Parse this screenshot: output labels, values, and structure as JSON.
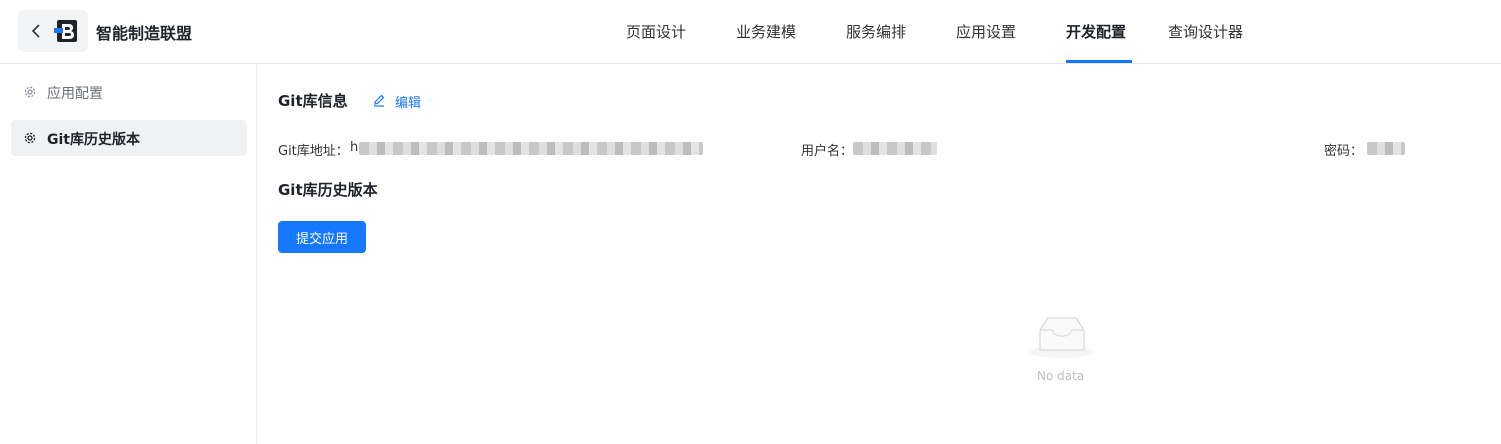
{
  "header": {
    "app_title": "智能制造联盟",
    "nav": [
      {
        "label": "页面设计",
        "active": false
      },
      {
        "label": "业务建模",
        "active": false
      },
      {
        "label": "服务编排",
        "active": false
      },
      {
        "label": "应用设置",
        "active": false
      },
      {
        "label": "开发配置",
        "active": true
      },
      {
        "label": "查询设计器",
        "active": false
      }
    ]
  },
  "sidebar": {
    "items": [
      {
        "label": "应用配置",
        "icon": "gear-icon",
        "selected": false
      },
      {
        "label": "Git库历史版本",
        "icon": "gear-icon",
        "selected": true
      }
    ]
  },
  "git_info": {
    "title": "Git库信息",
    "edit_label": "编辑",
    "address_label": "Git库地址：",
    "address_prefix": "h",
    "username_label": "用户名：",
    "password_label": "密码："
  },
  "history": {
    "title": "Git库历史版本",
    "submit_label": "提交应用",
    "empty_text": "No data"
  },
  "colors": {
    "accent": "#1677ff",
    "sidebar_selected_bg": "#f0f1f3"
  }
}
